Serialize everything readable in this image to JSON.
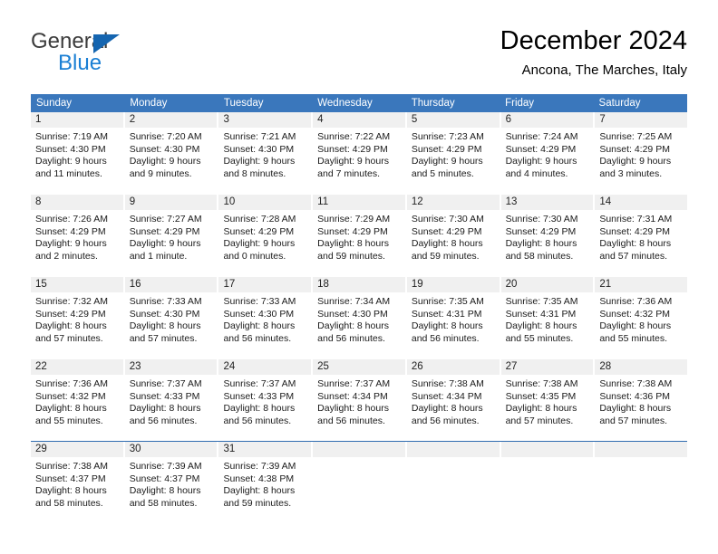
{
  "brand": {
    "name_part1": "General",
    "name_part2": "Blue",
    "triangle_color": "#1565b0",
    "blue_color": "#1a7fd4"
  },
  "header": {
    "title": "December 2024",
    "location": "Ancona, The Marches, Italy"
  },
  "theme": {
    "header_row_bg": "#3a77bc",
    "day_band_bg": "#f0f0f0",
    "last_row_border": "#2f6bb0"
  },
  "weekdays": [
    "Sunday",
    "Monday",
    "Tuesday",
    "Wednesday",
    "Thursday",
    "Friday",
    "Saturday"
  ],
  "weeks": [
    [
      {
        "day": "1",
        "sunrise": "Sunrise: 7:19 AM",
        "sunset": "Sunset: 4:30 PM",
        "daylight_line1": "Daylight: 9 hours",
        "daylight_line2": "and 11 minutes."
      },
      {
        "day": "2",
        "sunrise": "Sunrise: 7:20 AM",
        "sunset": "Sunset: 4:30 PM",
        "daylight_line1": "Daylight: 9 hours",
        "daylight_line2": "and 9 minutes."
      },
      {
        "day": "3",
        "sunrise": "Sunrise: 7:21 AM",
        "sunset": "Sunset: 4:30 PM",
        "daylight_line1": "Daylight: 9 hours",
        "daylight_line2": "and 8 minutes."
      },
      {
        "day": "4",
        "sunrise": "Sunrise: 7:22 AM",
        "sunset": "Sunset: 4:29 PM",
        "daylight_line1": "Daylight: 9 hours",
        "daylight_line2": "and 7 minutes."
      },
      {
        "day": "5",
        "sunrise": "Sunrise: 7:23 AM",
        "sunset": "Sunset: 4:29 PM",
        "daylight_line1": "Daylight: 9 hours",
        "daylight_line2": "and 5 minutes."
      },
      {
        "day": "6",
        "sunrise": "Sunrise: 7:24 AM",
        "sunset": "Sunset: 4:29 PM",
        "daylight_line1": "Daylight: 9 hours",
        "daylight_line2": "and 4 minutes."
      },
      {
        "day": "7",
        "sunrise": "Sunrise: 7:25 AM",
        "sunset": "Sunset: 4:29 PM",
        "daylight_line1": "Daylight: 9 hours",
        "daylight_line2": "and 3 minutes."
      }
    ],
    [
      {
        "day": "8",
        "sunrise": "Sunrise: 7:26 AM",
        "sunset": "Sunset: 4:29 PM",
        "daylight_line1": "Daylight: 9 hours",
        "daylight_line2": "and 2 minutes."
      },
      {
        "day": "9",
        "sunrise": "Sunrise: 7:27 AM",
        "sunset": "Sunset: 4:29 PM",
        "daylight_line1": "Daylight: 9 hours",
        "daylight_line2": "and 1 minute."
      },
      {
        "day": "10",
        "sunrise": "Sunrise: 7:28 AM",
        "sunset": "Sunset: 4:29 PM",
        "daylight_line1": "Daylight: 9 hours",
        "daylight_line2": "and 0 minutes."
      },
      {
        "day": "11",
        "sunrise": "Sunrise: 7:29 AM",
        "sunset": "Sunset: 4:29 PM",
        "daylight_line1": "Daylight: 8 hours",
        "daylight_line2": "and 59 minutes."
      },
      {
        "day": "12",
        "sunrise": "Sunrise: 7:30 AM",
        "sunset": "Sunset: 4:29 PM",
        "daylight_line1": "Daylight: 8 hours",
        "daylight_line2": "and 59 minutes."
      },
      {
        "day": "13",
        "sunrise": "Sunrise: 7:30 AM",
        "sunset": "Sunset: 4:29 PM",
        "daylight_line1": "Daylight: 8 hours",
        "daylight_line2": "and 58 minutes."
      },
      {
        "day": "14",
        "sunrise": "Sunrise: 7:31 AM",
        "sunset": "Sunset: 4:29 PM",
        "daylight_line1": "Daylight: 8 hours",
        "daylight_line2": "and 57 minutes."
      }
    ],
    [
      {
        "day": "15",
        "sunrise": "Sunrise: 7:32 AM",
        "sunset": "Sunset: 4:29 PM",
        "daylight_line1": "Daylight: 8 hours",
        "daylight_line2": "and 57 minutes."
      },
      {
        "day": "16",
        "sunrise": "Sunrise: 7:33 AM",
        "sunset": "Sunset: 4:30 PM",
        "daylight_line1": "Daylight: 8 hours",
        "daylight_line2": "and 57 minutes."
      },
      {
        "day": "17",
        "sunrise": "Sunrise: 7:33 AM",
        "sunset": "Sunset: 4:30 PM",
        "daylight_line1": "Daylight: 8 hours",
        "daylight_line2": "and 56 minutes."
      },
      {
        "day": "18",
        "sunrise": "Sunrise: 7:34 AM",
        "sunset": "Sunset: 4:30 PM",
        "daylight_line1": "Daylight: 8 hours",
        "daylight_line2": "and 56 minutes."
      },
      {
        "day": "19",
        "sunrise": "Sunrise: 7:35 AM",
        "sunset": "Sunset: 4:31 PM",
        "daylight_line1": "Daylight: 8 hours",
        "daylight_line2": "and 56 minutes."
      },
      {
        "day": "20",
        "sunrise": "Sunrise: 7:35 AM",
        "sunset": "Sunset: 4:31 PM",
        "daylight_line1": "Daylight: 8 hours",
        "daylight_line2": "and 55 minutes."
      },
      {
        "day": "21",
        "sunrise": "Sunrise: 7:36 AM",
        "sunset": "Sunset: 4:32 PM",
        "daylight_line1": "Daylight: 8 hours",
        "daylight_line2": "and 55 minutes."
      }
    ],
    [
      {
        "day": "22",
        "sunrise": "Sunrise: 7:36 AM",
        "sunset": "Sunset: 4:32 PM",
        "daylight_line1": "Daylight: 8 hours",
        "daylight_line2": "and 55 minutes."
      },
      {
        "day": "23",
        "sunrise": "Sunrise: 7:37 AM",
        "sunset": "Sunset: 4:33 PM",
        "daylight_line1": "Daylight: 8 hours",
        "daylight_line2": "and 56 minutes."
      },
      {
        "day": "24",
        "sunrise": "Sunrise: 7:37 AM",
        "sunset": "Sunset: 4:33 PM",
        "daylight_line1": "Daylight: 8 hours",
        "daylight_line2": "and 56 minutes."
      },
      {
        "day": "25",
        "sunrise": "Sunrise: 7:37 AM",
        "sunset": "Sunset: 4:34 PM",
        "daylight_line1": "Daylight: 8 hours",
        "daylight_line2": "and 56 minutes."
      },
      {
        "day": "26",
        "sunrise": "Sunrise: 7:38 AM",
        "sunset": "Sunset: 4:34 PM",
        "daylight_line1": "Daylight: 8 hours",
        "daylight_line2": "and 56 minutes."
      },
      {
        "day": "27",
        "sunrise": "Sunrise: 7:38 AM",
        "sunset": "Sunset: 4:35 PM",
        "daylight_line1": "Daylight: 8 hours",
        "daylight_line2": "and 57 minutes."
      },
      {
        "day": "28",
        "sunrise": "Sunrise: 7:38 AM",
        "sunset": "Sunset: 4:36 PM",
        "daylight_line1": "Daylight: 8 hours",
        "daylight_line2": "and 57 minutes."
      }
    ],
    [
      {
        "day": "29",
        "sunrise": "Sunrise: 7:38 AM",
        "sunset": "Sunset: 4:37 PM",
        "daylight_line1": "Daylight: 8 hours",
        "daylight_line2": "and 58 minutes."
      },
      {
        "day": "30",
        "sunrise": "Sunrise: 7:39 AM",
        "sunset": "Sunset: 4:37 PM",
        "daylight_line1": "Daylight: 8 hours",
        "daylight_line2": "and 58 minutes."
      },
      {
        "day": "31",
        "sunrise": "Sunrise: 7:39 AM",
        "sunset": "Sunset: 4:38 PM",
        "daylight_line1": "Daylight: 8 hours",
        "daylight_line2": "and 59 minutes."
      },
      {
        "day": "",
        "sunrise": "",
        "sunset": "",
        "daylight_line1": "",
        "daylight_line2": ""
      },
      {
        "day": "",
        "sunrise": "",
        "sunset": "",
        "daylight_line1": "",
        "daylight_line2": ""
      },
      {
        "day": "",
        "sunrise": "",
        "sunset": "",
        "daylight_line1": "",
        "daylight_line2": ""
      },
      {
        "day": "",
        "sunrise": "",
        "sunset": "",
        "daylight_line1": "",
        "daylight_line2": ""
      }
    ]
  ]
}
